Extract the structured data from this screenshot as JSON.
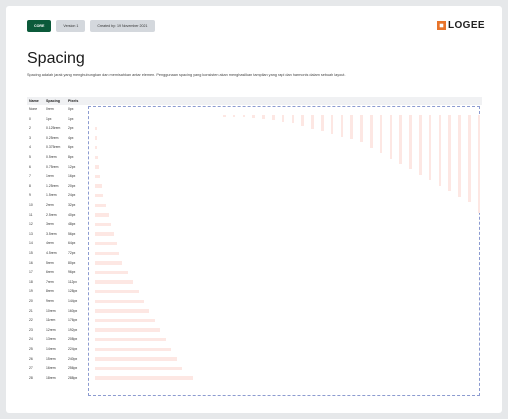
{
  "toolbar": {
    "code_tag": "CORE",
    "version": "Version 1",
    "updated": "Created by: 19 November 2021"
  },
  "brand": {
    "name": "LOGEE",
    "accent": "#e8742a"
  },
  "page": {
    "title": "Spacing",
    "description": "Spacing adalah jarak yang menghubungkan dan memisahkan antar elemen. Penggunaan spacing yang konsisten akan menghasilkan tampilan yang rapi dan harmonis dalam sebuah layout."
  },
  "table": {
    "headers": [
      "Name",
      "Spacing",
      "Pixels"
    ],
    "rows": [
      [
        "None",
        "0rem",
        "0px"
      ],
      [
        "0",
        "1px",
        "1px"
      ],
      [
        "2",
        "0.125rem",
        "2px"
      ],
      [
        "3",
        "0.25rem",
        "4px"
      ],
      [
        "4",
        "0.375rem",
        "6px"
      ],
      [
        "5",
        "0.5rem",
        "8px"
      ],
      [
        "6",
        "0.75rem",
        "12px"
      ],
      [
        "7",
        "1rem",
        "16px"
      ],
      [
        "8",
        "1.25rem",
        "20px"
      ],
      [
        "9",
        "1.5rem",
        "24px"
      ],
      [
        "10",
        "2rem",
        "32px"
      ],
      [
        "11",
        "2.5rem",
        "40px"
      ],
      [
        "12",
        "3rem",
        "48px"
      ],
      [
        "13",
        "3.5rem",
        "56px"
      ],
      [
        "14",
        "4rem",
        "64px"
      ],
      [
        "15",
        "4.5rem",
        "72px"
      ],
      [
        "16",
        "5rem",
        "80px"
      ],
      [
        "17",
        "6rem",
        "96px"
      ],
      [
        "18",
        "7rem",
        "112px"
      ],
      [
        "19",
        "8rem",
        "128px"
      ],
      [
        "20",
        "9rem",
        "144px"
      ],
      [
        "21",
        "10rem",
        "160px"
      ],
      [
        "22",
        "11rem",
        "176px"
      ],
      [
        "23",
        "12rem",
        "192px"
      ],
      [
        "24",
        "13rem",
        "208px"
      ],
      [
        "25",
        "14rem",
        "224px"
      ],
      [
        "26",
        "15rem",
        "240px"
      ],
      [
        "27",
        "16rem",
        "256px"
      ],
      [
        "28",
        "18rem",
        "288px"
      ]
    ],
    "bar_color": "#fde7e3",
    "guide_color": "#8c9bd0"
  }
}
